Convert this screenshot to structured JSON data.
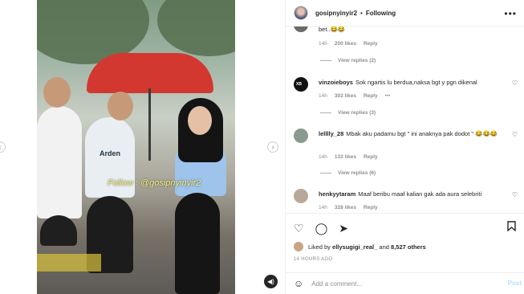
{
  "post": {
    "username": "gosipnyinyir2",
    "separator": "•",
    "follow_status": "Following",
    "more_icon": "more-horizontal-icon"
  },
  "media": {
    "overlay_caption": "Follow : @gosipnyinyir2",
    "jersey_text": "Arden",
    "prev_icon": "chevron-left-icon",
    "next_icon": "chevron-right-icon",
    "mute_icon": "speaker-icon"
  },
  "comments": {
    "partial": {
      "text": "bet..😂😂",
      "time": "14h",
      "likes": "200 likes",
      "reply": "Reply",
      "view_replies": "View replies (2)"
    },
    "items": [
      {
        "username": "vinzoieboys",
        "text": "Sok ngartis lu berdua,naksa bgt y pgn dikenal",
        "time": "14h",
        "likes": "302 likes",
        "reply": "Reply",
        "options": "•••",
        "view_replies": "View replies (3)",
        "avatar_color": "#111111"
      },
      {
        "username": "lelllly_28",
        "text": "Mbak aku padamu bgt \" ini anaknya pak dodot \" 😂😂😂",
        "time": "14h",
        "likes": "133 likes",
        "reply": "Reply",
        "view_replies": "View replies (6)",
        "avatar_color": "#8a9a8e"
      },
      {
        "username": "henkyytaram",
        "text": "Maaf beribu maaf kalian gak ada aura selebriti",
        "time": "14h",
        "likes": "328 likes",
        "reply": "Reply",
        "avatar_color": "#b8a89a"
      }
    ]
  },
  "actions": {
    "like_icon": "heart-icon",
    "comment_icon": "comment-icon",
    "share_icon": "send-icon",
    "save_icon": "bookmark-icon",
    "liked_by_prefix": "Liked by",
    "liked_by_user": "ellysugigi_real_",
    "liked_by_joiner": "and",
    "liked_by_count": "8,527 others",
    "time_ago": "14 HOURS AGO"
  },
  "add_comment": {
    "emoji_icon": "emoji-icon",
    "placeholder": "Add a comment...",
    "post_label": "Post"
  }
}
